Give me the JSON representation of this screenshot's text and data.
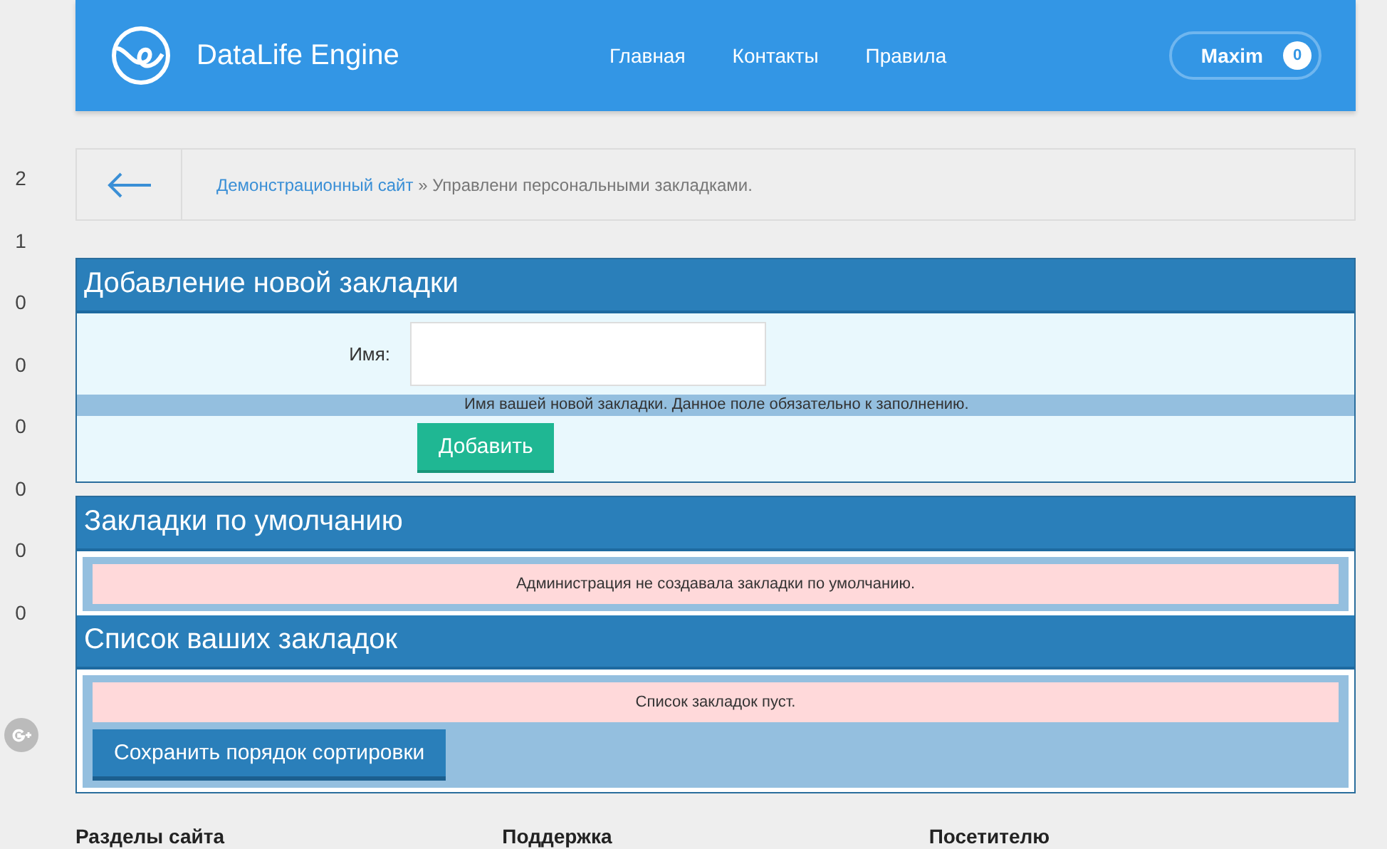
{
  "header": {
    "logo": "DataLife Engine",
    "nav": [
      {
        "label": "Главная"
      },
      {
        "label": "Контакты"
      },
      {
        "label": "Правила"
      }
    ],
    "user": {
      "name": "Maxim",
      "count": "0"
    }
  },
  "side_counts": [
    "2",
    "1",
    "0",
    "0",
    "0",
    "0",
    "0",
    "0"
  ],
  "breadcrumb": {
    "link": "Демонстрационный сайт",
    "rest": "» Управлени персональными закладками."
  },
  "add_panel": {
    "title": "Добавление новой закладки",
    "field_label": "Имя:",
    "hint": "Имя вашей новой закладки. Данное поле обязательно к заполнению.",
    "button": "Добавить"
  },
  "default_panel": {
    "title": "Закладки по умолчанию",
    "message": "Администрация не создавала закладки по умолчанию."
  },
  "list_panel": {
    "title": "Список ваших закладок",
    "message": "Список закладок пуст.",
    "button": "Сохранить порядок сортировки"
  },
  "footer": [
    {
      "title": "Разделы сайта"
    },
    {
      "title": "Поддержка"
    },
    {
      "title": "Посетителю"
    }
  ]
}
